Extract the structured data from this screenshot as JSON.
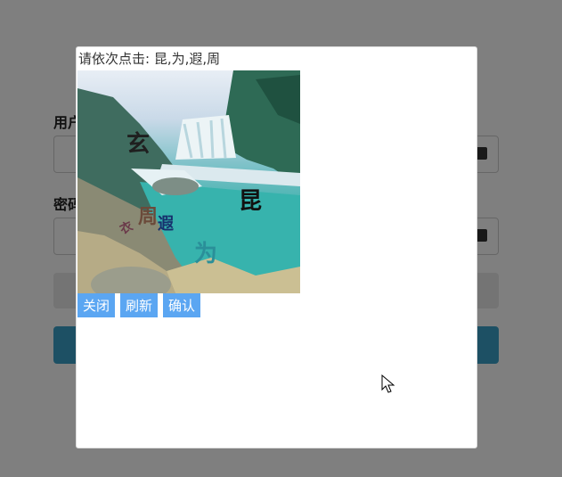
{
  "login_form": {
    "username_label": "用户",
    "password_label": "密码"
  },
  "captcha_modal": {
    "prompt": "请依次点击: 昆,为,遐,周",
    "characters": [
      {
        "char": "玄",
        "color": "#1f1f1f"
      },
      {
        "char": "昆",
        "color": "#111111"
      },
      {
        "char": "周",
        "color": "#6b4a3a"
      },
      {
        "char": "遐",
        "color": "#16306d"
      },
      {
        "char": "为",
        "color": "#2a8f99"
      },
      {
        "char": "衣",
        "color": "#6b3a4a"
      }
    ],
    "buttons": {
      "close": "关闭",
      "refresh": "刷新",
      "confirm": "确认"
    }
  }
}
